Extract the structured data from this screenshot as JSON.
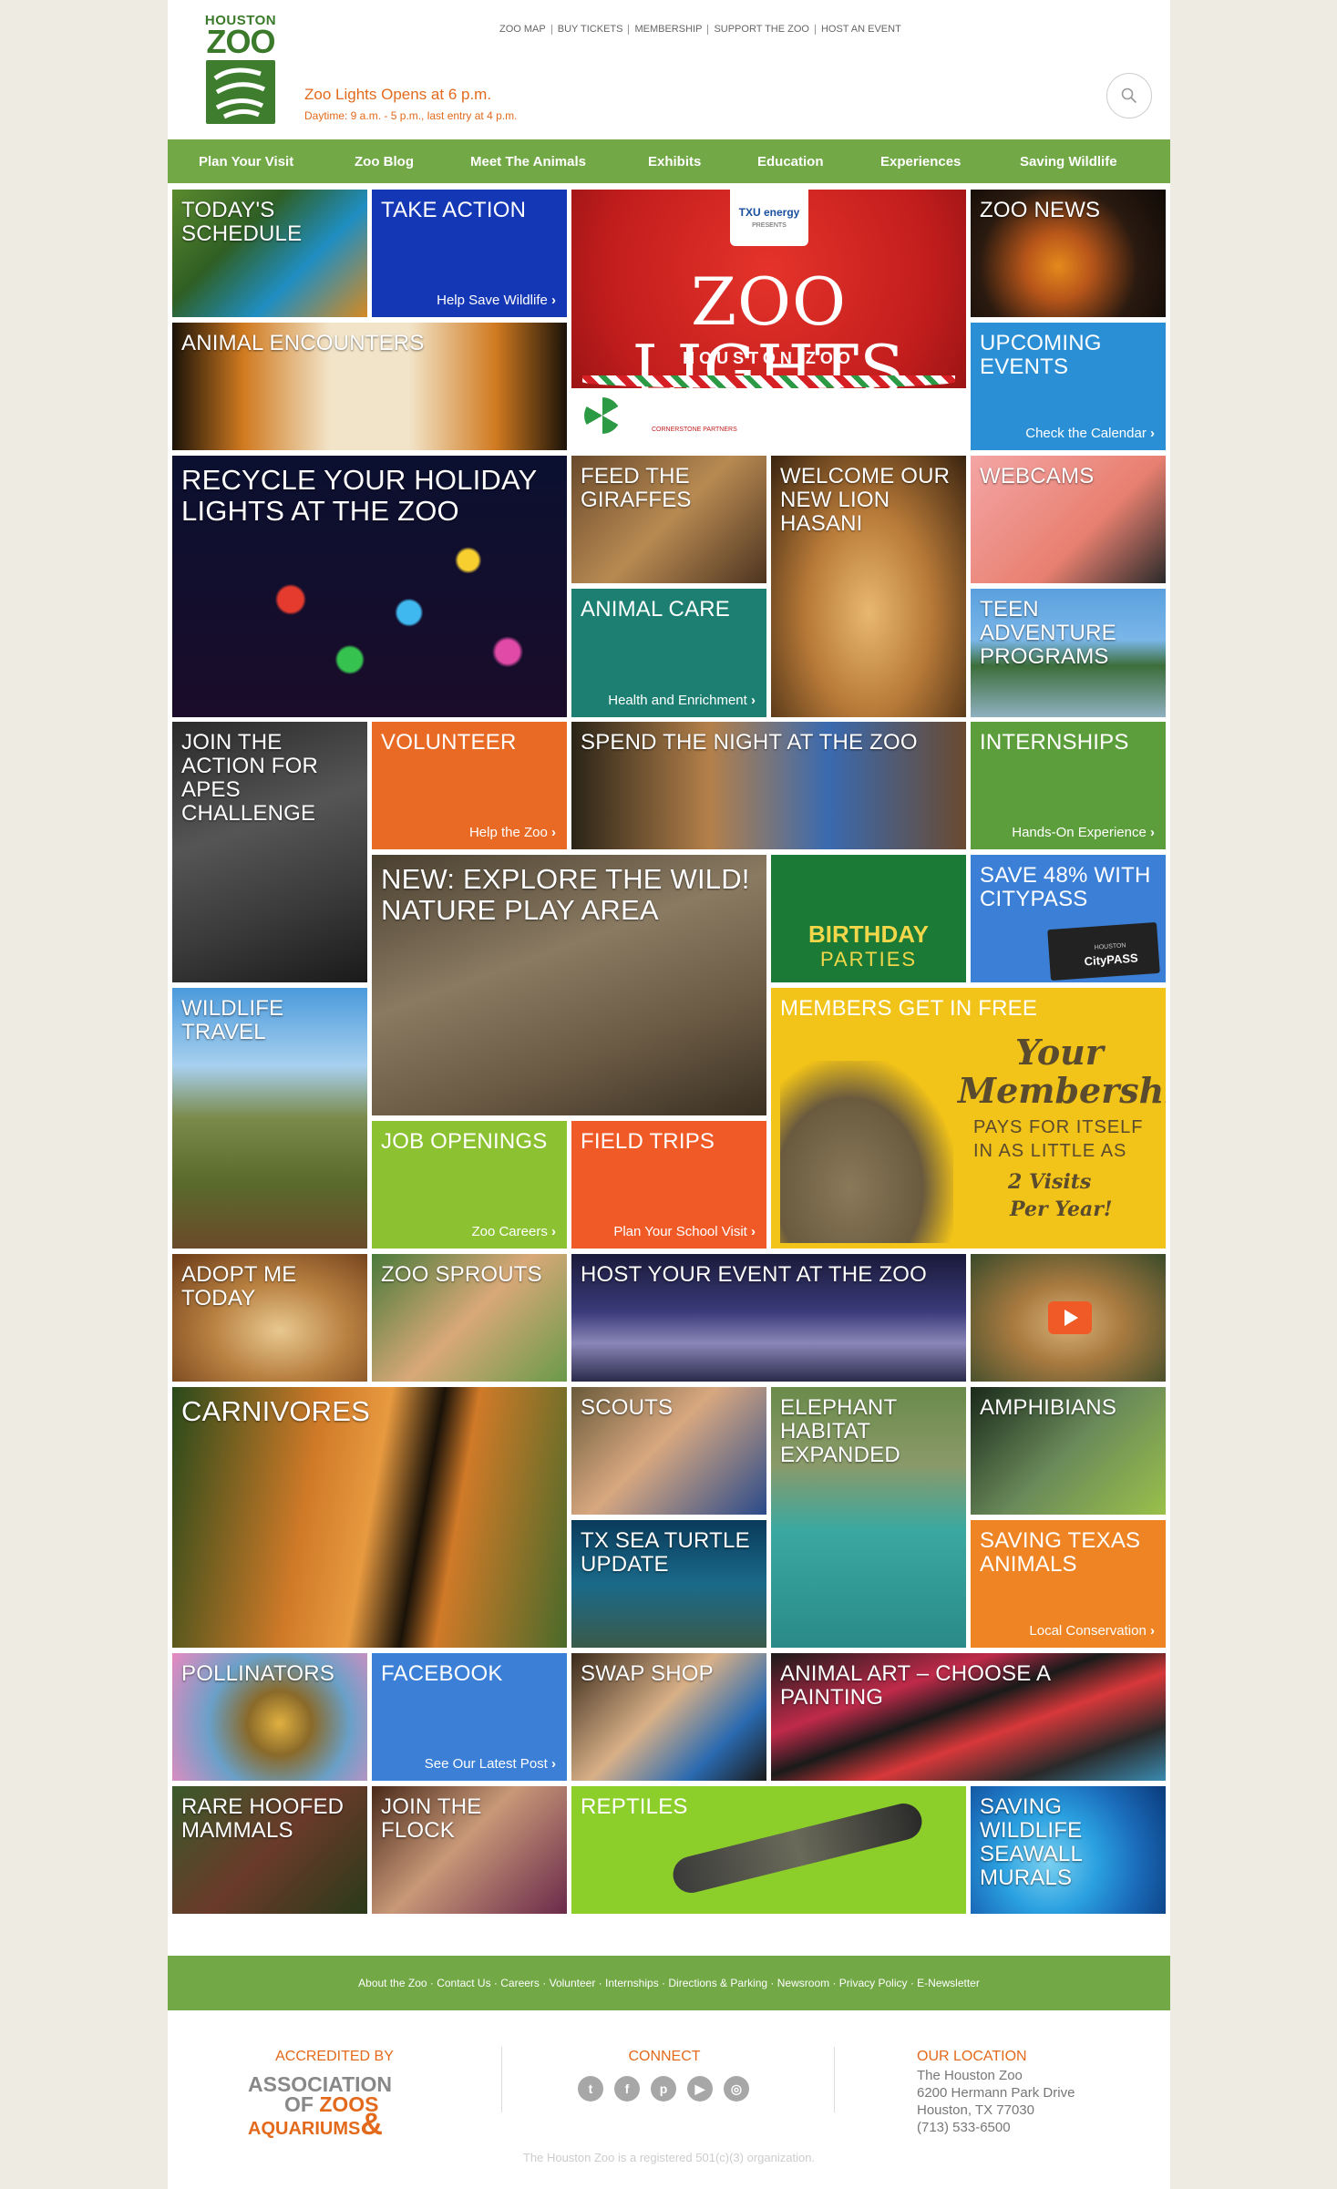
{
  "logo": {
    "line1": "HOUSTON",
    "line2": "ZOO"
  },
  "top_links": [
    "ZOO MAP",
    "BUY TICKETS",
    "MEMBERSHIP",
    "SUPPORT THE ZOO",
    "HOST AN EVENT"
  ],
  "notice": {
    "headline": "Zoo Lights Opens at 6 p.m.",
    "detail": "Daytime: 9 a.m. - 5 p.m., last entry at 4 p.m."
  },
  "nav": [
    "Plan Your Visit",
    "Zoo Blog",
    "Meet The Animals",
    "Exhibits",
    "Education",
    "Experiences",
    "Saving Wildlife"
  ],
  "tiles": {
    "todays_schedule": {
      "title": "TODAY'S SCHEDULE"
    },
    "take_action": {
      "title": "TAKE ACTION",
      "sub": "Help Save Wildlife"
    },
    "zoo_lights": {
      "sponsor": "TXU energy",
      "presents": "PRESENTS",
      "title": "ZOO LIGHTS",
      "subtitle": "HOUSTON ZOO",
      "partners": "CORNERSTONE PARTNERS"
    },
    "zoo_news": {
      "title": "ZOO NEWS"
    },
    "animal_encounters": {
      "title": "ANIMAL ENCOUNTERS"
    },
    "upcoming_events": {
      "title": "UPCOMING EVENTS",
      "sub": "Check the Calendar"
    },
    "recycle_lights": {
      "title": "RECYCLE YOUR HOLIDAY LIGHTS AT THE ZOO"
    },
    "feed_giraffes": {
      "title": "FEED THE GIRAFFES"
    },
    "welcome_lion": {
      "title": "WELCOME OUR NEW LION HASANI"
    },
    "webcams": {
      "title": "WEBCAMS"
    },
    "animal_care": {
      "title": "ANIMAL CARE",
      "sub": "Health and Enrichment"
    },
    "teen_adventure": {
      "title": "TEEN ADVENTURE PROGRAMS"
    },
    "apes_challenge": {
      "title": "JOIN THE ACTION FOR APES CHALLENGE"
    },
    "volunteer": {
      "title": "VOLUNTEER",
      "sub": "Help the Zoo"
    },
    "spend_night": {
      "title": "SPEND THE NIGHT AT THE ZOO"
    },
    "internships": {
      "title": "INTERNSHIPS",
      "sub": "Hands-On Experience"
    },
    "nature_play": {
      "title": "NEW: EXPLORE THE WILD! NATURE PLAY AREA"
    },
    "birthday": {
      "title": "BIRTHDAY",
      "title2": "PARTIES"
    },
    "citypass": {
      "title": "SAVE 48% WITH CITYPASS",
      "card_city": "HOUSTON",
      "card_brand": "CityPASS"
    },
    "wildlife_travel": {
      "title": "WILDLIFE TRAVEL"
    },
    "members_free": {
      "title": "MEMBERS GET IN FREE",
      "line1": "Your",
      "line2": "Membership",
      "line3": "PAYS FOR ITSELF",
      "line4": "IN AS LITTLE AS",
      "line5": "2 Visits",
      "line6": "Per Year!"
    },
    "job_openings": {
      "title": "JOB OPENINGS",
      "sub": "Zoo Careers"
    },
    "field_trips": {
      "title": "FIELD TRIPS",
      "sub": "Plan Your School Visit"
    },
    "adopt_me": {
      "title": "ADOPT ME TODAY"
    },
    "zoo_sprouts": {
      "title": "ZOO SPROUTS"
    },
    "host_event": {
      "title": "HOST YOUR EVENT AT THE ZOO"
    },
    "carnivores": {
      "title": "CARNIVORES"
    },
    "scouts": {
      "title": "SCOUTS"
    },
    "elephant": {
      "title": "ELEPHANT HABITAT EXPANDED"
    },
    "amphibians": {
      "title": "AMPHIBIANS"
    },
    "sea_turtle": {
      "title": "TX SEA TURTLE UPDATE"
    },
    "saving_texas": {
      "title": "SAVING TEXAS ANIMALS",
      "sub": "Local Conservation"
    },
    "pollinators": {
      "title": "POLLINATORS"
    },
    "facebook": {
      "title": "FACEBOOK",
      "sub": "See Our Latest Post"
    },
    "swap_shop": {
      "title": "SWAP SHOP"
    },
    "animal_art": {
      "title": "ANIMAL ART – CHOOSE A PAINTING"
    },
    "rare_hoofed": {
      "title": "RARE HOOFED MAMMALS"
    },
    "join_flock": {
      "title": "JOIN THE FLOCK"
    },
    "reptiles": {
      "title": "REPTILES"
    },
    "seawall": {
      "title": "SAVING WILDLIFE SEAWALL MURALS"
    }
  },
  "footer": {
    "links": [
      "About the Zoo",
      "Contact Us",
      "Careers",
      "Volunteer",
      "Internships",
      "Directions & Parking",
      "Newsroom",
      "Privacy Policy",
      "E-Newsletter"
    ],
    "accredited_label": "ACCREDITED BY",
    "aza": {
      "line1": "ASSOCIATION",
      "line2a": "OF",
      "line2b": "ZOOS",
      "line3": "AQUARIUMS",
      "amp": "&"
    },
    "connect_label": "CONNECT",
    "location_label": "OUR LOCATION",
    "address": [
      "The Houston Zoo",
      "6200 Hermann Park Drive",
      "Houston, TX 77030",
      "(713) 533-6500"
    ],
    "legal": "The Houston Zoo is a registered 501(c)(3) organization."
  },
  "colors": {
    "green": "#72a846",
    "blue_dark": "#1437b5",
    "blue_light": "#2b8fd6",
    "orange": "#e86a24",
    "teal": "#1c7f72",
    "lime": "#8cc232",
    "orange_red": "#ef5a27",
    "yellow": "#f2c318",
    "dark_green": "#1a7a36",
    "city_blue": "#3b7fd6",
    "accent": "#e36a1c"
  }
}
